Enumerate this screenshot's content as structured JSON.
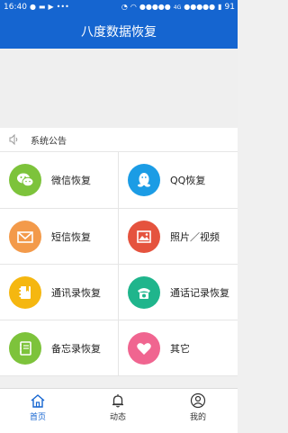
{
  "status_bar": {
    "time": "16:40",
    "network": "4G",
    "battery": "91"
  },
  "header": {
    "title": "八度数据恢复"
  },
  "notice": {
    "label": "系统公告"
  },
  "features": [
    {
      "label": "微信恢复",
      "color": "#7dc33b",
      "icon": "wechat-icon"
    },
    {
      "label": "QQ恢复",
      "color": "#1b9ce5",
      "icon": "qq-penguin-icon"
    },
    {
      "label": "短信恢复",
      "color": "#f39a4a",
      "icon": "envelope-icon"
    },
    {
      "label": "照片／视频",
      "color": "#e5533e",
      "icon": "image-icon"
    },
    {
      "label": "通讯录恢复",
      "color": "#f5b710",
      "icon": "contact-book-icon"
    },
    {
      "label": "通话记录恢复",
      "color": "#1fb58c",
      "icon": "telephone-icon"
    },
    {
      "label": "备忘录恢复",
      "color": "#7dc33b",
      "icon": "notebook-icon"
    },
    {
      "label": "其它",
      "color": "#f06590",
      "icon": "heart-icon"
    }
  ],
  "tabs": [
    {
      "label": "首页",
      "icon": "home-icon",
      "active": true
    },
    {
      "label": "动态",
      "icon": "bell-icon",
      "active": false
    },
    {
      "label": "我的",
      "icon": "user-icon",
      "active": false
    }
  ],
  "colors": {
    "primary": "#1565d0"
  }
}
